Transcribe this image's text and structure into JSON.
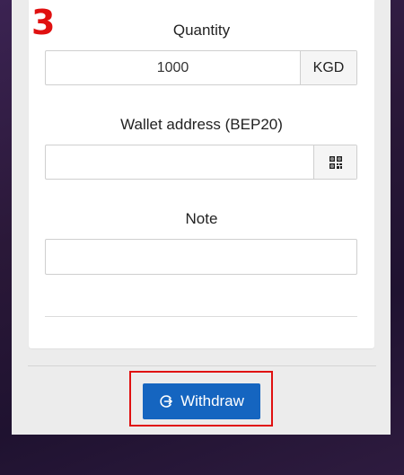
{
  "annotation": {
    "step_number": "3"
  },
  "form": {
    "quantity": {
      "label": "Quantity",
      "value": "1000",
      "unit": "KGD"
    },
    "wallet": {
      "label": "Wallet address (BEP20)",
      "value": "",
      "addon_icon": "qr-code-icon"
    },
    "note": {
      "label": "Note",
      "value": ""
    }
  },
  "actions": {
    "withdraw_label": "Withdraw",
    "withdraw_icon": "withdraw-icon"
  },
  "colors": {
    "primary": "#1565c0",
    "highlight": "#e01010",
    "background": "#2a1838"
  }
}
